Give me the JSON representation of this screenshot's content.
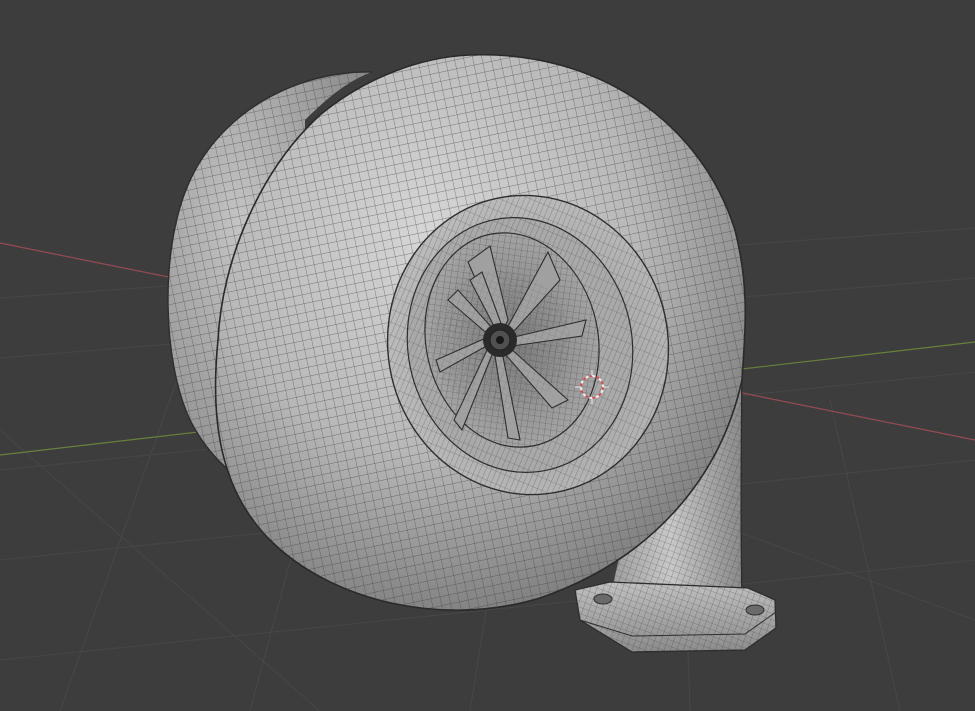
{
  "viewport": {
    "background_color": "#3d3d3d",
    "grid_color": "#4a4a4a",
    "x_axis_color": "#a14b55",
    "y_axis_color": "#6a8a3a",
    "shading": "solid-wireframe"
  },
  "model": {
    "name": "turbocharger",
    "surface_color": "#b4b4b4",
    "wire_color": "#3a3a3a",
    "parts": [
      "scroll-housing",
      "rear-housing",
      "compressor-inlet",
      "compressor-wheel",
      "hub-nut",
      "outlet-pipe",
      "outlet-flange"
    ],
    "compressor_blade_count": 9,
    "flange_bolt_holes": 2
  },
  "cursor_3d": {
    "ring_color_a": "#e04a4a",
    "ring_color_b": "#f0f0f0"
  }
}
